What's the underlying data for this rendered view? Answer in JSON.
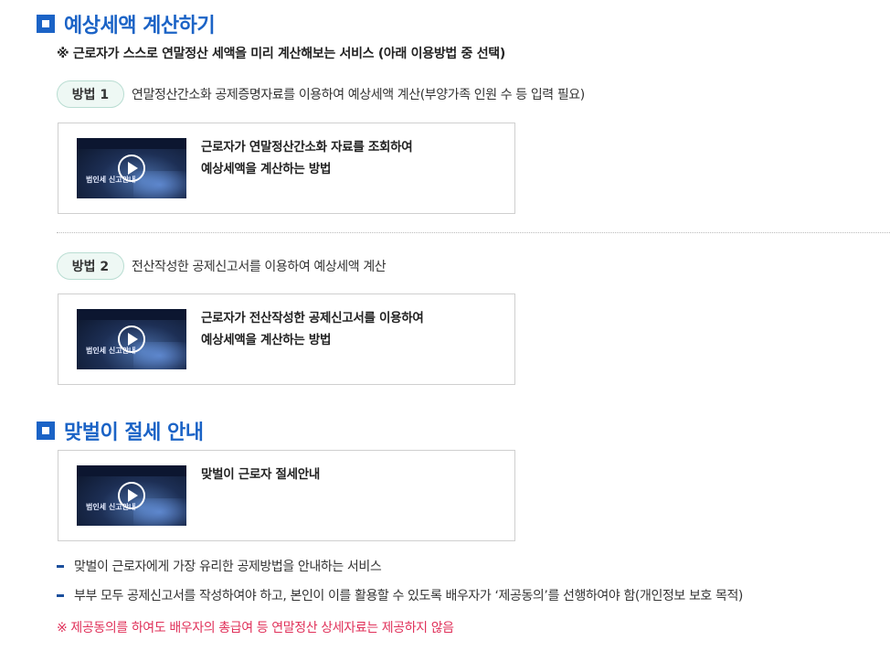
{
  "section1": {
    "title": "예상세액 계산하기",
    "note": "※ 근로자가 스스로 연말정산 세액을 미리 계산해보는 서비스 (아래 이용방법 중 선택)"
  },
  "method1": {
    "label": "방법 1",
    "desc": "연말정산간소화 공제증명자료를 이용하여 예상세액 계산(부양가족 인원 수 등 입력 필요)",
    "video": {
      "thumb_text": "범인세 신고안내",
      "line1": "근로자가 연말정산간소화 자료를 조회하여",
      "line2": "예상세액을 계산하는 방법"
    }
  },
  "method2": {
    "label": "방법 2",
    "desc": "전산작성한 공제신고서를 이용하여 예상세액 계산",
    "video": {
      "thumb_text": "범인세 신고안내",
      "line1": "근로자가 전산작성한 공제신고서를 이용하여",
      "line2": "예상세액을 계산하는 방법"
    }
  },
  "section2": {
    "title": "맞벌이 절세 안내",
    "video": {
      "thumb_text": "범인세 신고안내",
      "line1": "맞벌이 근로자 절세안내"
    },
    "bullets": [
      "맞벌이 근로자에게 가장 유리한 공제방법을 안내하는 서비스",
      "부부 모두 공제신고서를 작성하여야 하고, 본인이 이를 활용할 수 있도록 배우자가 ‘제공동의’를 선행하여야 함(개인정보 보호 목적)"
    ],
    "warning": "※ 제공동의를 하여도 배우자의 총급여 등 연말정산 상세자료는 제공하지 않음"
  },
  "colors": {
    "accent": "#1b63c6",
    "pill_bg": "#eef8f4",
    "warning": "#e0315a"
  }
}
